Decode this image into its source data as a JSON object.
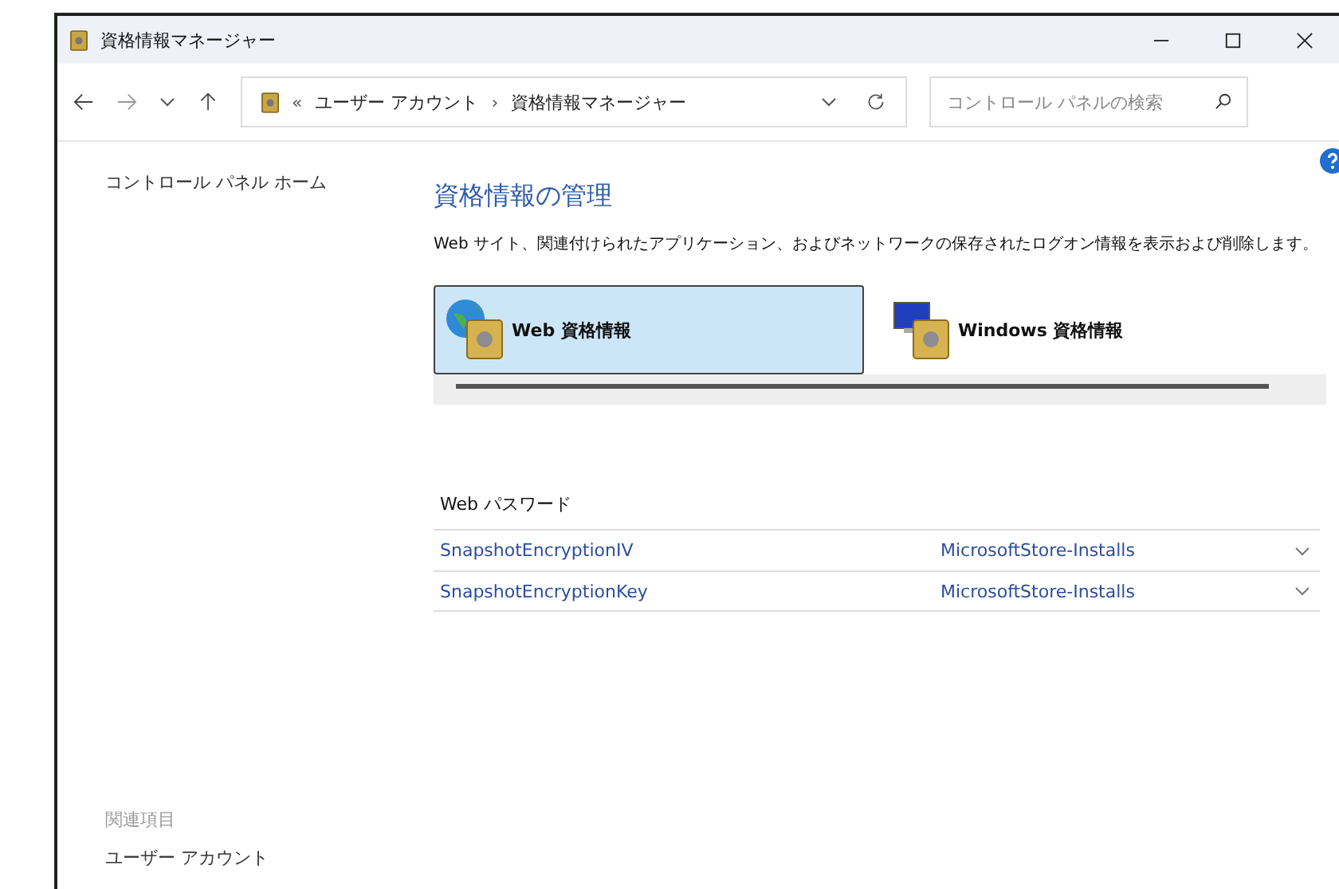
{
  "window": {
    "title": "資格情報マネージャー"
  },
  "address": {
    "separator": "«",
    "path": [
      "ユーザー アカウント",
      "資格情報マネージャー"
    ],
    "path_separator": "›"
  },
  "search": {
    "placeholder": "コントロール パネルの検索"
  },
  "sidebar": {
    "home": "コントロール パネル ホーム",
    "related_heading": "関連項目",
    "related_links": [
      "ユーザー アカウント"
    ]
  },
  "main": {
    "heading": "資格情報の管理",
    "description": "Web サイト、関連付けられたアプリケーション、およびネットワークの保存されたログオン情報を表示および削除します。"
  },
  "tabs": [
    {
      "label": "Web 資格情報",
      "kind": "web",
      "selected": true
    },
    {
      "label": "Windows 資格情報",
      "kind": "windows",
      "selected": false
    }
  ],
  "section": {
    "title": "Web パスワード",
    "rows": [
      {
        "name": "SnapshotEncryptionIV",
        "source": "MicrosoftStore-Installs"
      },
      {
        "name": "SnapshotEncryptionKey",
        "source": "MicrosoftStore-Installs"
      }
    ]
  }
}
